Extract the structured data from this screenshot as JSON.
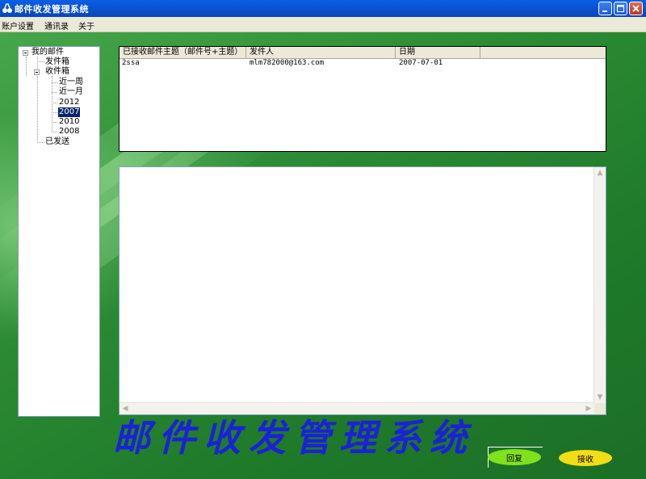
{
  "window": {
    "title": "邮件收发管理系统",
    "buttons": {
      "minimize": "minimize",
      "maximize": "maximize",
      "close": "close"
    }
  },
  "menu": {
    "items": [
      "账户设置",
      "通讯录",
      "关于"
    ]
  },
  "tree": {
    "root": "我的邮件",
    "outbox": "发件箱",
    "inbox": "收件箱",
    "inbox_children": [
      "近一周",
      "近一月",
      "2012",
      "2007",
      "2010",
      "2008"
    ],
    "selected": "2007",
    "sent": "已发送"
  },
  "list": {
    "columns": [
      "已接收邮件主题（邮件号+主题）",
      "发件人",
      "日期",
      ""
    ],
    "rows": [
      {
        "subject": "2ssa",
        "sender": "mlm782000@163.com",
        "date": "2007-07-01"
      }
    ]
  },
  "banner": {
    "text": "邮件收发管理系统",
    "color": "#1a22d6"
  },
  "actions": {
    "reply_label": "回复",
    "receive_label": "接收"
  },
  "colors": {
    "titlebar": "#0a5fe6",
    "background_green": "#2a8a32",
    "selection": "#0a246a"
  }
}
